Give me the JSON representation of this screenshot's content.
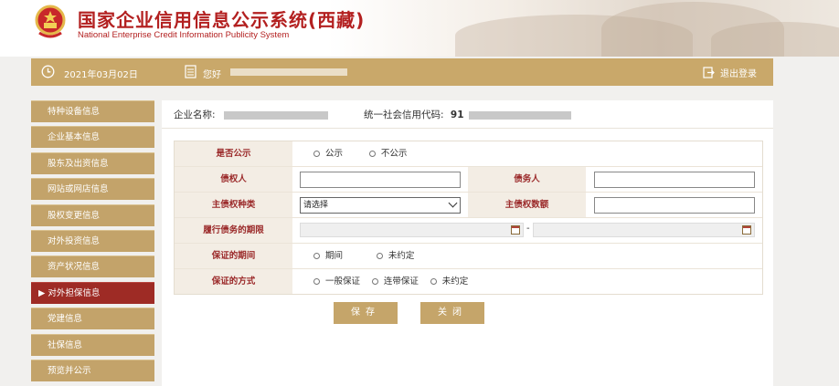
{
  "header": {
    "title": "国家企业信用信息公示系统(西藏)",
    "subtitle": "National Enterprise Credit Information Publicity System"
  },
  "topbar": {
    "date": "2021年03月02日",
    "user_prefix": "您好",
    "logout": "退出登录"
  },
  "sidebar": {
    "items": [
      {
        "label": "特种设备信息"
      },
      {
        "label": "企业基本信息"
      },
      {
        "label": "股东及出资信息"
      },
      {
        "label": "网站或网店信息"
      },
      {
        "label": "股权变更信息"
      },
      {
        "label": "对外投资信息"
      },
      {
        "label": "资产状况信息"
      },
      {
        "label": "▶ 对外担保信息"
      },
      {
        "label": "党建信息"
      },
      {
        "label": "社保信息"
      },
      {
        "label": "预览并公示"
      }
    ],
    "active_index": 7
  },
  "company": {
    "name_label": "企业名称:",
    "code_label": "统一社会信用代码:",
    "code_value_prefix": "91"
  },
  "form": {
    "publicize_label": "是否公示",
    "publicize_options": [
      "公示",
      "不公示"
    ],
    "creditor_label": "债权人",
    "debtor_label": "债务人",
    "claim_type_label": "主债权种类",
    "claim_type_value": "请选择",
    "claim_amount_label": "主债权数额",
    "term_label": "履行债务的期限",
    "term_separator": "-",
    "guarantee_period_label": "保证的期间",
    "guarantee_period_options": [
      "期间",
      "未约定"
    ],
    "guarantee_method_label": "保证的方式",
    "guarantee_method_options": [
      "一般保证",
      "连带保证",
      "未约定"
    ]
  },
  "buttons": {
    "save": "保存",
    "close": "关闭"
  },
  "colors": {
    "brand_red": "#b32020",
    "gold": "#c9a86a",
    "active": "#9e2b25"
  }
}
